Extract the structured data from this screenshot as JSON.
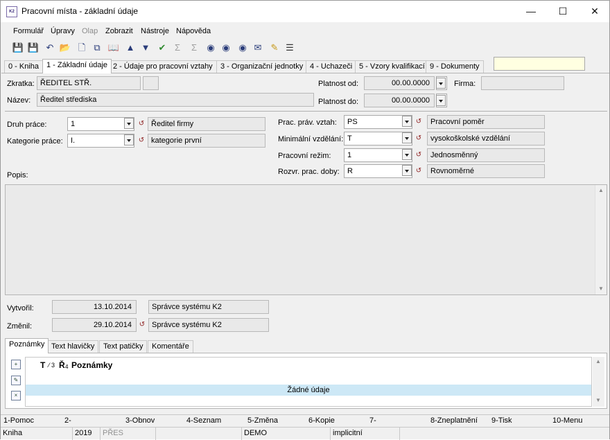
{
  "window": {
    "title": "Pracovní místa - základní údaje",
    "app_icon_text": "K2"
  },
  "menu": [
    {
      "label": "Formulář"
    },
    {
      "label": "Úpravy"
    },
    {
      "label": "Olap"
    },
    {
      "label": "Zobrazit"
    },
    {
      "label": "Nástroje"
    },
    {
      "label": "Nápověda"
    }
  ],
  "tabs": [
    {
      "label": "0 - Kniha"
    },
    {
      "label": "1 - Základní údaje"
    },
    {
      "label": "2 - Údaje pro pracovní vztahy"
    },
    {
      "label": "3 - Organizační jednotky"
    },
    {
      "label": "4 - Uchazeči"
    },
    {
      "label": "5 - Vzory kvalifikací"
    },
    {
      "label": "9 - Dokumenty"
    }
  ],
  "form": {
    "zkratka_label": "Zkratka:",
    "zkratka_value": "ŘEDITEL STŘ.",
    "nazev_label": "Název:",
    "nazev_value": "Ředitel střediska",
    "platnost_od_label": "Platnost od:",
    "platnost_od_value": "00.00.0000",
    "platnost_do_label": "Platnost do:",
    "platnost_do_value": "00.00.0000",
    "firma_label": "Firma:",
    "firma_value": "",
    "druh_prace_label": "Druh práce:",
    "druh_prace_value": "1",
    "druh_prace_desc": "Ředitel firmy",
    "kategorie_prace_label": "Kategorie práce:",
    "kategorie_prace_value": "I.",
    "kategorie_prace_desc": "kategorie první",
    "prac_prav_vztah_label": "Prac. práv. vztah:",
    "prac_prav_vztah_value": "PS",
    "prac_prav_vztah_desc": "Pracovní poměr",
    "min_vzdelani_label": "Minimální vzdělání:",
    "min_vzdelani_value": "T",
    "min_vzdelani_desc": "vysokoškolské vzdělání",
    "prac_rezim_label": "Pracovní režim:",
    "prac_rezim_value": "1",
    "prac_rezim_desc": "Jednosměnný",
    "rozvr_label": "Rozvr. prac. doby:",
    "rozvr_value": "R",
    "rozvr_desc": "Rovnoměrné",
    "popis_label": "Popis:",
    "vytvoril_label": "Vytvořil:",
    "vytvoril_date": "13.10.2014",
    "vytvoril_user": "Správce systému K2",
    "zmenil_label": "Změnil:",
    "zmenil_date": "29.10.2014",
    "zmenil_user": "Správce systému K2"
  },
  "subtabs": [
    {
      "label": "Poznámky"
    },
    {
      "label": "Text hlavičky"
    },
    {
      "label": "Text patičky"
    },
    {
      "label": "Komentáře"
    }
  ],
  "notes_grid": {
    "col_t": "T",
    "col_slash": "⁄ 3",
    "col_r": "Ř",
    "col_r_sub": "4",
    "header": "Poznámky",
    "empty": "Žádné údaje"
  },
  "fkeys": [
    "1-Pomoc",
    "2-",
    "3-Obnov",
    "4-Seznam",
    "5-Změna",
    "6-Kopie",
    "7-",
    "8-Zneplatnění",
    "9-Tisk",
    "10-Menu"
  ],
  "status": {
    "book": "Kniha",
    "year": "2019",
    "mode": "PŘES",
    "db": "DEMO",
    "setting": "implicitní"
  }
}
